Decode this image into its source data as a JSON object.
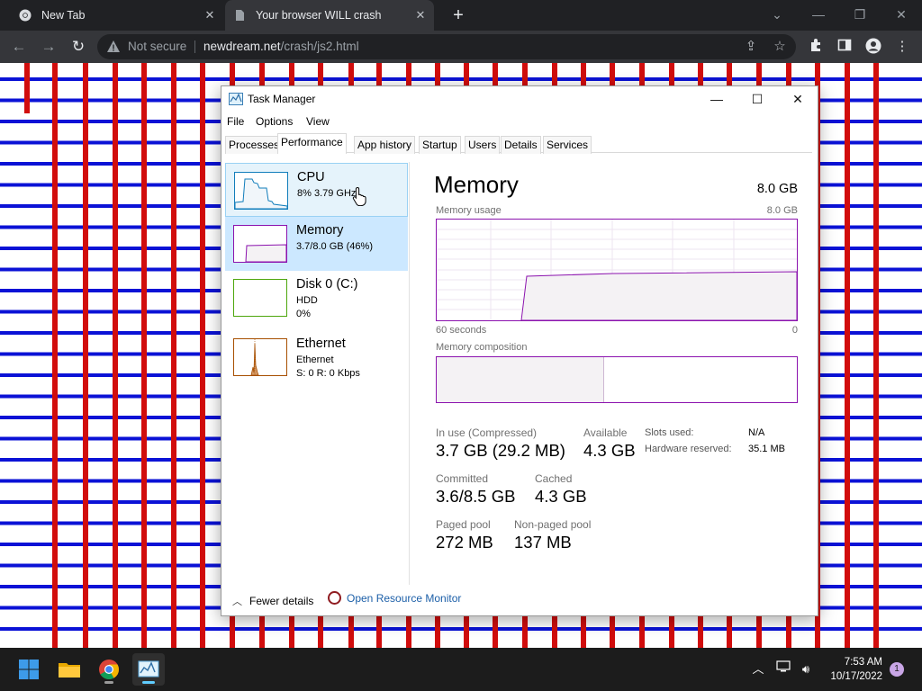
{
  "browser": {
    "tabs": [
      {
        "title": "New Tab"
      },
      {
        "title": "Your browser WILL crash"
      }
    ],
    "address": {
      "security": "Not secure",
      "host": "newdream.net",
      "path": "/crash/js2.html"
    }
  },
  "task_manager": {
    "title": "Task Manager",
    "menu": [
      "File",
      "Options",
      "View"
    ],
    "tabs": [
      "Processes",
      "Performance",
      "App history",
      "Startup",
      "Users",
      "Details",
      "Services"
    ],
    "active_tab": "Performance",
    "sidebar": [
      {
        "name": "CPU",
        "sub1": "8%  3.79 GHz",
        "color": "#117dbb"
      },
      {
        "name": "Memory",
        "sub1": "3.7/8.0 GB (46%)",
        "color": "#8b12ae"
      },
      {
        "name": "Disk 0 (C:)",
        "sub1": "HDD",
        "sub2": "0%",
        "color": "#4da60c"
      },
      {
        "name": "Ethernet",
        "sub1": "Ethernet",
        "sub2": "S: 0  R: 0 Kbps",
        "color": "#a74f01"
      }
    ],
    "memory": {
      "title": "Memory",
      "total": "8.0 GB",
      "usage_label": "Memory usage",
      "usage_max": "8.0 GB",
      "axis_left": "60 seconds",
      "axis_right": "0",
      "composition_label": "Memory composition",
      "in_use_label": "In use (Compressed)",
      "in_use_value": "3.7 GB (29.2 MB)",
      "available_label": "Available",
      "available_value": "4.3 GB",
      "committed_label": "Committed",
      "committed_value": "3.6/8.5 GB",
      "cached_label": "Cached",
      "cached_value": "4.3 GB",
      "paged_label": "Paged pool",
      "paged_value": "272 MB",
      "nonpaged_label": "Non-paged pool",
      "nonpaged_value": "137 MB",
      "slots_label": "Slots used:",
      "slots_value": "N/A",
      "hw_label": "Hardware reserved:",
      "hw_value": "35.1 MB"
    },
    "footer": {
      "fewer": "Fewer details",
      "resource_monitor": "Open Resource Monitor"
    }
  },
  "taskbar": {
    "time": "7:53 AM",
    "date": "10/17/2022",
    "notifications": "1"
  }
}
